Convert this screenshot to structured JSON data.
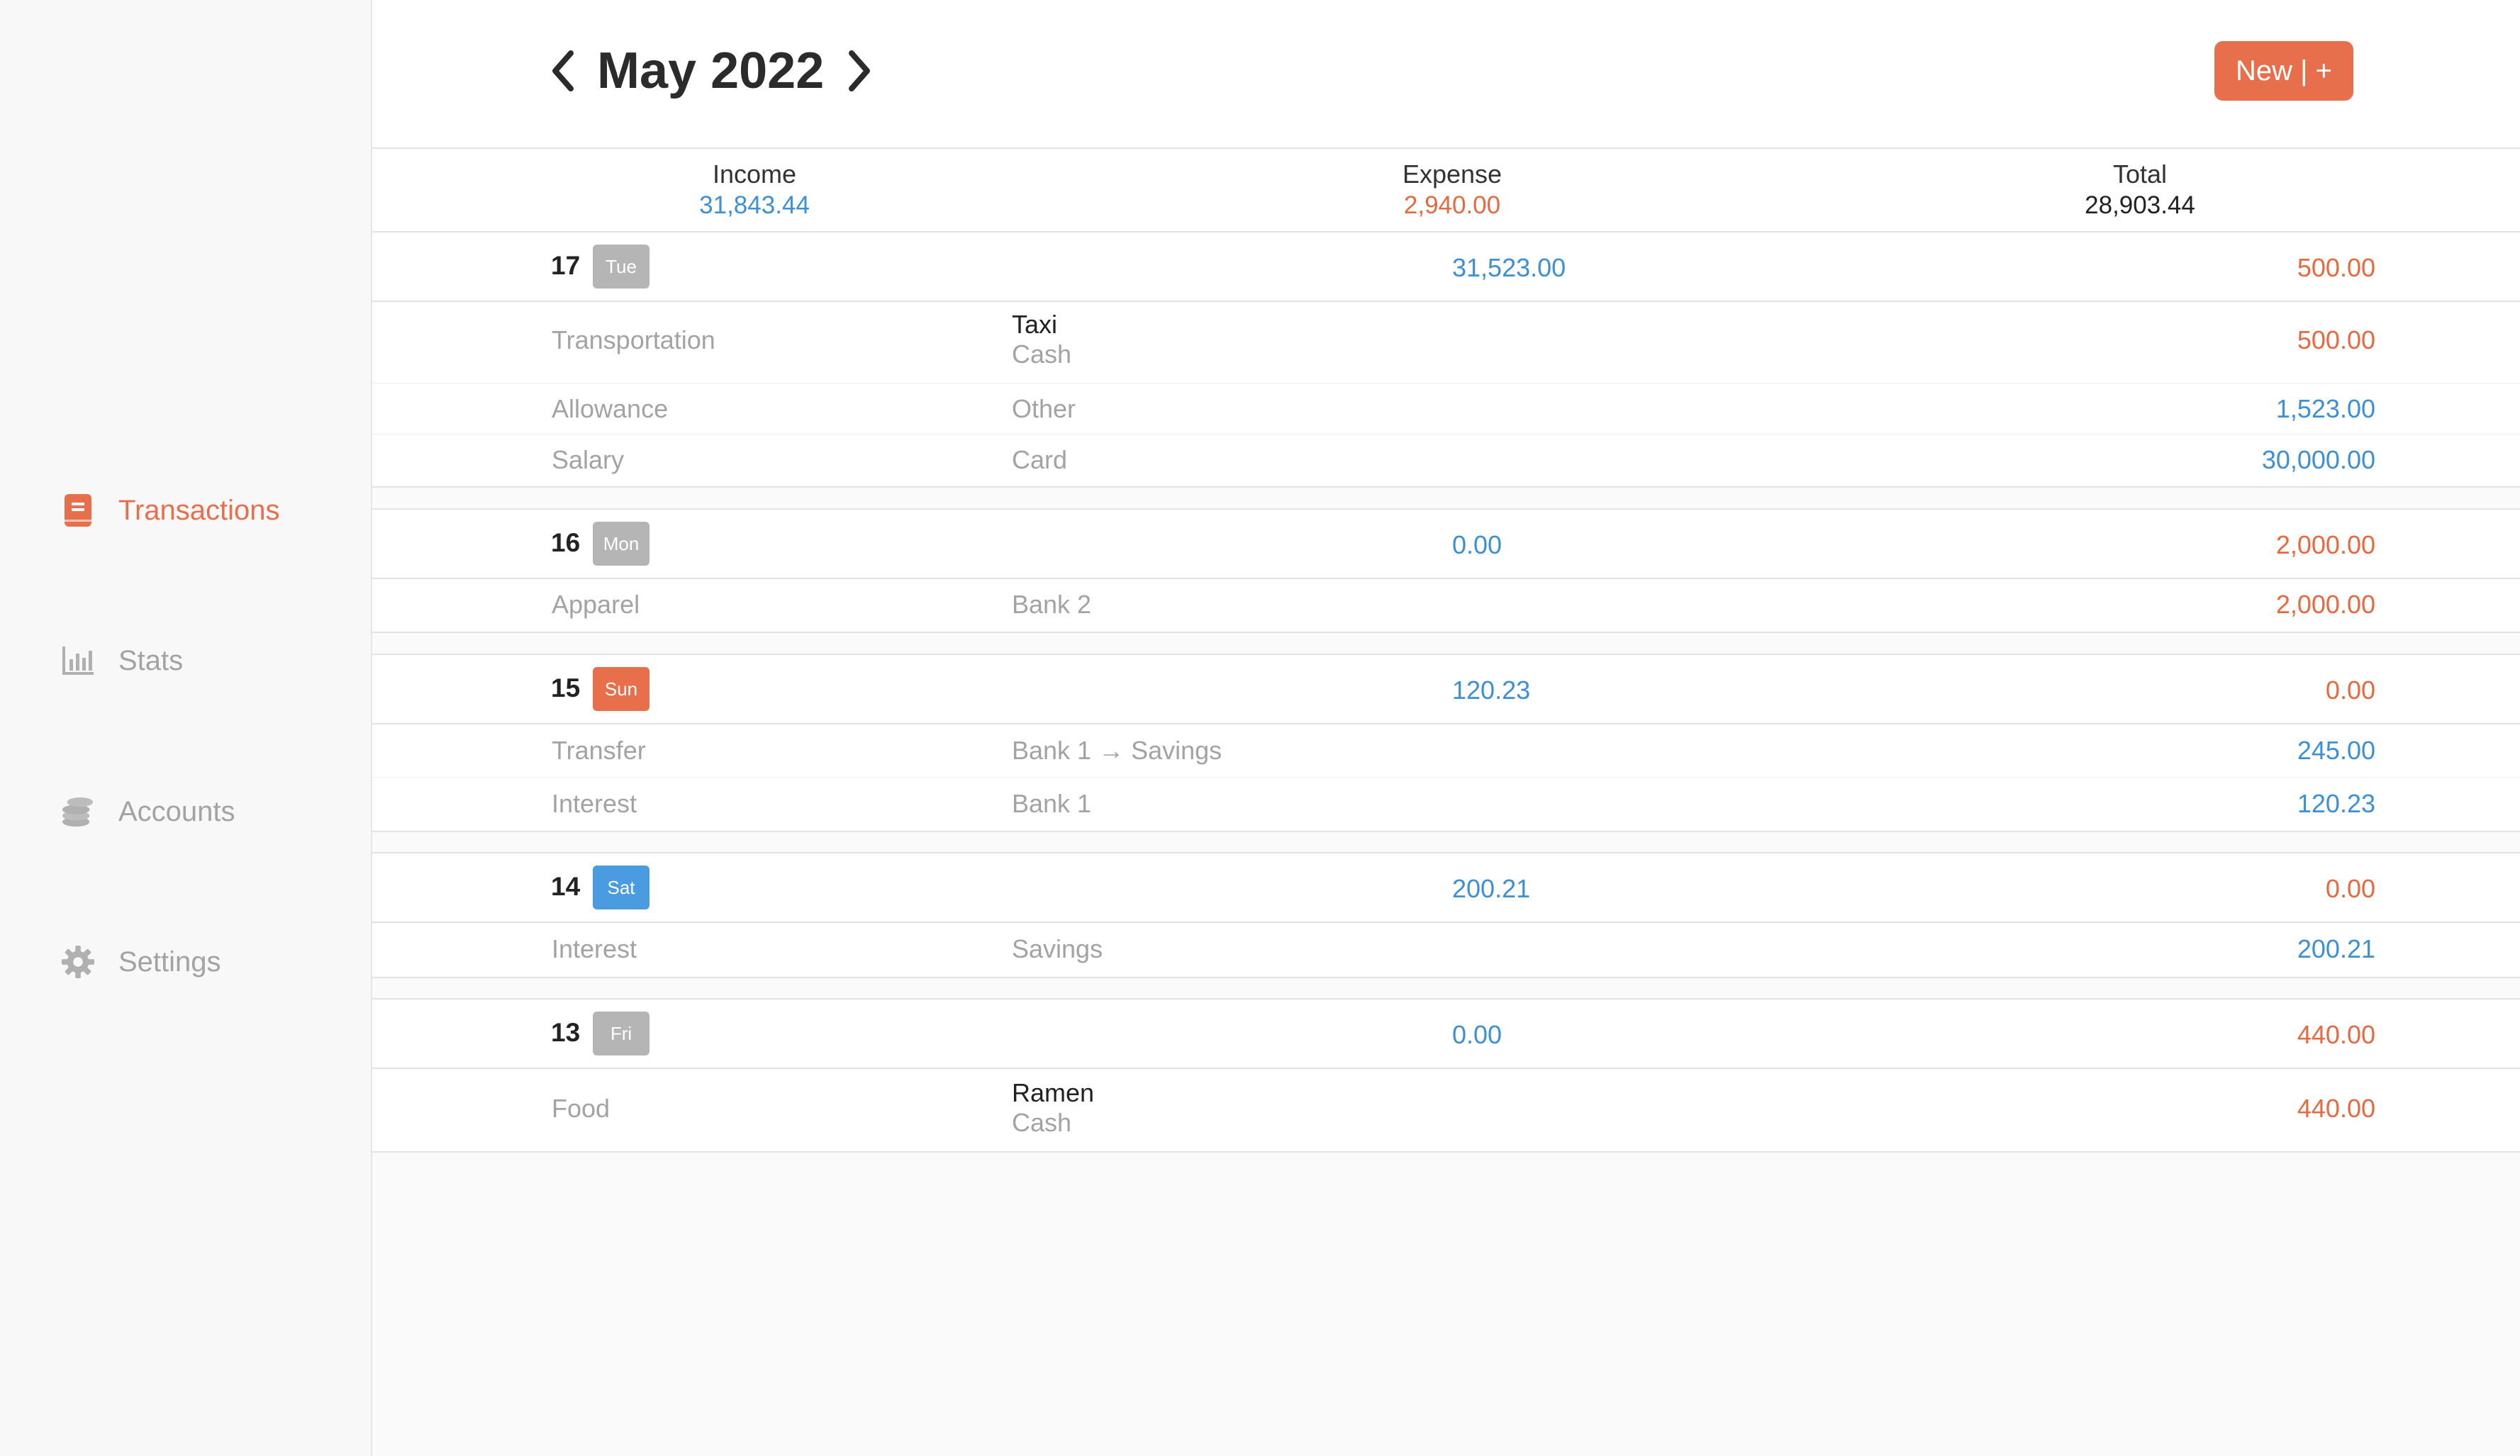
{
  "sidebar": {
    "items": [
      {
        "label": "Transactions",
        "icon": "book-icon",
        "active": true
      },
      {
        "label": "Stats",
        "icon": "bar-chart-icon",
        "active": false
      },
      {
        "label": "Accounts",
        "icon": "coins-icon",
        "active": false
      },
      {
        "label": "Settings",
        "icon": "gear-icon",
        "active": false
      }
    ]
  },
  "header": {
    "month": "May 2022",
    "new_button": "New | +"
  },
  "summary": {
    "income_label": "Income",
    "income_value": "31,843.44",
    "expense_label": "Expense",
    "expense_value": "2,940.00",
    "total_label": "Total",
    "total_value": "28,903.44"
  },
  "days": [
    {
      "day": "17",
      "weekday": "Tue",
      "income": "31,523.00",
      "expense": "500.00",
      "transactions": [
        {
          "category": "Transportation",
          "note": "Taxi",
          "account": "Cash",
          "amount": "500.00",
          "type": "expense"
        },
        {
          "category": "Allowance",
          "note": "",
          "account": "Other",
          "amount": "1,523.00",
          "type": "income"
        },
        {
          "category": "Salary",
          "note": "",
          "account": "Card",
          "amount": "30,000.00",
          "type": "income"
        }
      ]
    },
    {
      "day": "16",
      "weekday": "Mon",
      "income": "0.00",
      "expense": "2,000.00",
      "transactions": [
        {
          "category": "Apparel",
          "note": "",
          "account": "Bank 2",
          "amount": "2,000.00",
          "type": "expense"
        }
      ]
    },
    {
      "day": "15",
      "weekday": "Sun",
      "income": "120.23",
      "expense": "0.00",
      "transactions": [
        {
          "category": "Transfer",
          "note": "",
          "account": "Bank 1 → Savings",
          "amount": "245.00",
          "type": "income"
        },
        {
          "category": "Interest",
          "note": "",
          "account": "Bank 1",
          "amount": "120.23",
          "type": "income"
        }
      ]
    },
    {
      "day": "14",
      "weekday": "Sat",
      "income": "200.21",
      "expense": "0.00",
      "transactions": [
        {
          "category": "Interest",
          "note": "",
          "account": "Savings",
          "amount": "200.21",
          "type": "income"
        }
      ]
    },
    {
      "day": "13",
      "weekday": "Fri",
      "income": "0.00",
      "expense": "440.00",
      "transactions": [
        {
          "category": "Food",
          "note": "Ramen",
          "account": "Cash",
          "amount": "440.00",
          "type": "expense"
        }
      ]
    }
  ],
  "colors": {
    "accent": "#e86f4c",
    "income": "#3d8fd6",
    "expense": "#e8683f",
    "weekday_badge": "#b5b5b5",
    "sunday_badge": "#e86f4c",
    "saturday_badge": "#4a9be0"
  }
}
